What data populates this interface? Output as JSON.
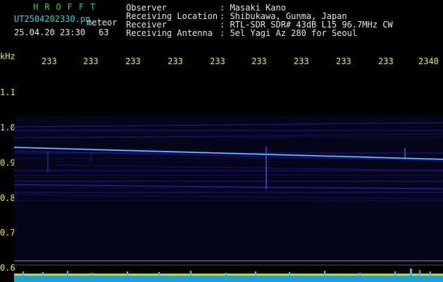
{
  "brand": "HROFFT",
  "file_name": "UT2504202330.pn",
  "mode": "meteor",
  "datetime": "25.04.20 23:30",
  "count": "63",
  "header": [
    {
      "label": "Observer",
      "value": ": Masaki Kano"
    },
    {
      "label": "Receiving Location",
      "value": ": Shibukawa, Gunma, Japan"
    },
    {
      "label": "Receiver",
      "value": ": RTL-SDR SDR# 43dB L15 96.7MHz CW"
    },
    {
      "label": "Receiving Antenna",
      "value": ": 5el Yagi Az 280 for Seoul"
    }
  ],
  "y_unit": "kHz",
  "y_ticks": [
    "1.1",
    "1.0",
    "0.9",
    "0.8",
    "0.7",
    "0.6"
  ],
  "x_ticks": [
    "233",
    "233",
    "233",
    "233",
    "233",
    "233",
    "233",
    "233",
    "233",
    "2340"
  ],
  "colors": {
    "background": "#000000",
    "text_header": "#e6e6e6",
    "brand": "#33d24a",
    "file": "#2fd6d6",
    "axis": "#e8e84a"
  }
}
